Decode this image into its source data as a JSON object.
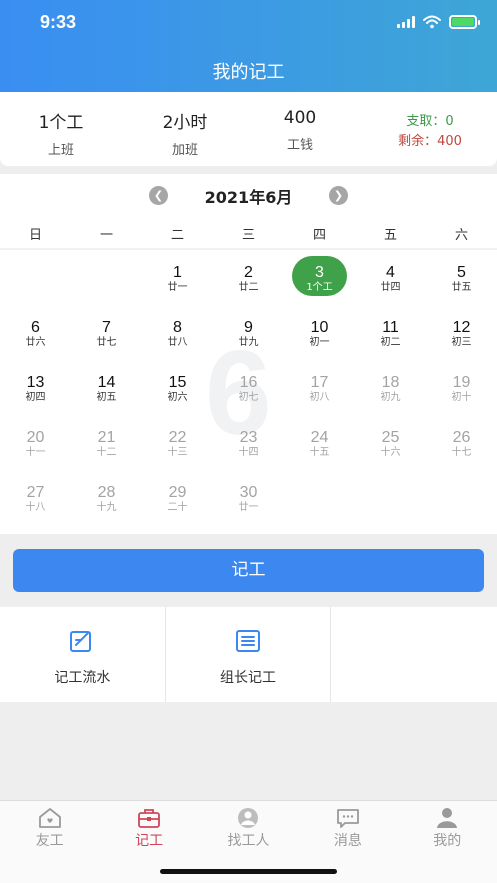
{
  "status_bar": {
    "time": "9:33",
    "battery_color": "#4cd964"
  },
  "header": {
    "title": "我的记工",
    "gradient": [
      "#3a8ef2",
      "#3ea6d6"
    ]
  },
  "summary": {
    "work": {
      "value": "1个工",
      "label": "上班"
    },
    "overtime": {
      "value": "2小时",
      "label": "加班"
    },
    "wage": {
      "value": "400",
      "label": "工钱"
    },
    "paid": "支取：0",
    "remaining": "剩余：400"
  },
  "calendar": {
    "prev_icon": "chevron-left-icon",
    "next_icon": "chevron-right-icon",
    "month_title": "2021年6月",
    "watermark": "6",
    "weekdays": [
      "日",
      "一",
      "二",
      "三",
      "四",
      "五",
      "六"
    ],
    "leading_blanks": 2,
    "selected_color": "#3fa14a",
    "days": [
      {
        "day": "1",
        "lunar": "廿一",
        "state": "past"
      },
      {
        "day": "2",
        "lunar": "廿二",
        "state": "past"
      },
      {
        "day": "3",
        "lunar": "1个工",
        "state": "selected"
      },
      {
        "day": "4",
        "lunar": "廿四",
        "state": "past"
      },
      {
        "day": "5",
        "lunar": "廿五",
        "state": "past"
      },
      {
        "day": "6",
        "lunar": "廿六",
        "state": "past"
      },
      {
        "day": "7",
        "lunar": "廿七",
        "state": "past"
      },
      {
        "day": "8",
        "lunar": "廿八",
        "state": "past"
      },
      {
        "day": "9",
        "lunar": "廿九",
        "state": "past"
      },
      {
        "day": "10",
        "lunar": "初一",
        "state": "past"
      },
      {
        "day": "11",
        "lunar": "初二",
        "state": "past"
      },
      {
        "day": "12",
        "lunar": "初三",
        "state": "past"
      },
      {
        "day": "13",
        "lunar": "初四",
        "state": "past"
      },
      {
        "day": "14",
        "lunar": "初五",
        "state": "past"
      },
      {
        "day": "15",
        "lunar": "初六",
        "state": "past"
      },
      {
        "day": "16",
        "lunar": "初七",
        "state": "future"
      },
      {
        "day": "17",
        "lunar": "初八",
        "state": "future"
      },
      {
        "day": "18",
        "lunar": "初九",
        "state": "future"
      },
      {
        "day": "19",
        "lunar": "初十",
        "state": "future"
      },
      {
        "day": "20",
        "lunar": "十一",
        "state": "future"
      },
      {
        "day": "21",
        "lunar": "十二",
        "state": "future"
      },
      {
        "day": "22",
        "lunar": "十三",
        "state": "future"
      },
      {
        "day": "23",
        "lunar": "十四",
        "state": "future"
      },
      {
        "day": "24",
        "lunar": "十五",
        "state": "future"
      },
      {
        "day": "25",
        "lunar": "十六",
        "state": "future"
      },
      {
        "day": "26",
        "lunar": "十七",
        "state": "future"
      },
      {
        "day": "27",
        "lunar": "十八",
        "state": "future"
      },
      {
        "day": "28",
        "lunar": "十九",
        "state": "future"
      },
      {
        "day": "29",
        "lunar": "二十",
        "state": "future"
      },
      {
        "day": "30",
        "lunar": "廿一",
        "state": "future"
      }
    ]
  },
  "record_button": {
    "label": "记工",
    "color": "#3d88f0"
  },
  "actions": [
    {
      "label": "记工流水",
      "icon": "edit-note-icon"
    },
    {
      "label": "组长记工",
      "icon": "list-board-icon"
    }
  ],
  "tabbar": {
    "active_color": "#d0455a",
    "tabs": [
      {
        "label": "友工",
        "icon": "home-heart-icon"
      },
      {
        "label": "记工",
        "icon": "briefcase-icon"
      },
      {
        "label": "找工人",
        "icon": "find-worker-icon"
      },
      {
        "label": "消息",
        "icon": "message-icon"
      },
      {
        "label": "我的",
        "icon": "person-icon"
      }
    ]
  }
}
